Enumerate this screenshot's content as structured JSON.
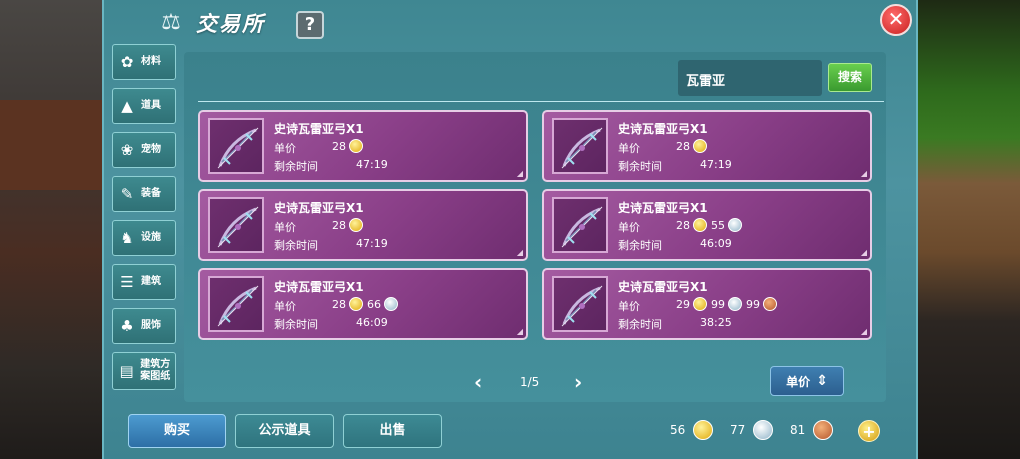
{
  "header": {
    "title": "交易所",
    "help_label": "?",
    "close_label": "✕"
  },
  "sidebar": {
    "items": [
      {
        "label": "材料",
        "icon": "materials-icon"
      },
      {
        "label": "道具",
        "icon": "item-icon"
      },
      {
        "label": "宠物",
        "icon": "pet-icon"
      },
      {
        "label": "装备",
        "icon": "equipment-icon"
      },
      {
        "label": "设施",
        "icon": "facility-icon"
      },
      {
        "label": "建筑",
        "icon": "building-icon"
      },
      {
        "label": "服饰",
        "icon": "clothing-icon"
      },
      {
        "label": "建筑方案图纸",
        "icon": "blueprint-icon"
      }
    ]
  },
  "search": {
    "value": "瓦雷亚",
    "button_label": "搜索"
  },
  "listing_labels": {
    "price": "单价",
    "time": "剩余时间"
  },
  "listings": [
    {
      "name": "史诗瓦雷亚弓X1",
      "gold": "28",
      "silver": "",
      "copper": "",
      "time": "47:19"
    },
    {
      "name": "史诗瓦雷亚弓X1",
      "gold": "28",
      "silver": "",
      "copper": "",
      "time": "47:19"
    },
    {
      "name": "史诗瓦雷亚弓X1",
      "gold": "28",
      "silver": "",
      "copper": "",
      "time": "47:19"
    },
    {
      "name": "史诗瓦雷亚弓X1",
      "gold": "28",
      "silver": "55",
      "copper": "",
      "time": "46:09"
    },
    {
      "name": "史诗瓦雷亚弓X1",
      "gold": "28",
      "silver": "66",
      "copper": "",
      "time": "46:09"
    },
    {
      "name": "史诗瓦雷亚弓X1",
      "gold": "29",
      "silver": "99",
      "copper": "99",
      "time": "38:25"
    }
  ],
  "pager": {
    "text": "1/5",
    "prev": "‹",
    "next": "›"
  },
  "sort": {
    "label": "单价"
  },
  "buttons": {
    "buy": "购买",
    "publish": "公示道具",
    "sell": "出售"
  },
  "currency": {
    "gold": "56",
    "silver": "77",
    "copper": "81"
  },
  "colors": {
    "card_bg": "#8a3f88",
    "panel_bg": "#4d93a0",
    "gold": "#e0a90b",
    "silver": "#8fb3c8",
    "copper": "#b5562b"
  }
}
